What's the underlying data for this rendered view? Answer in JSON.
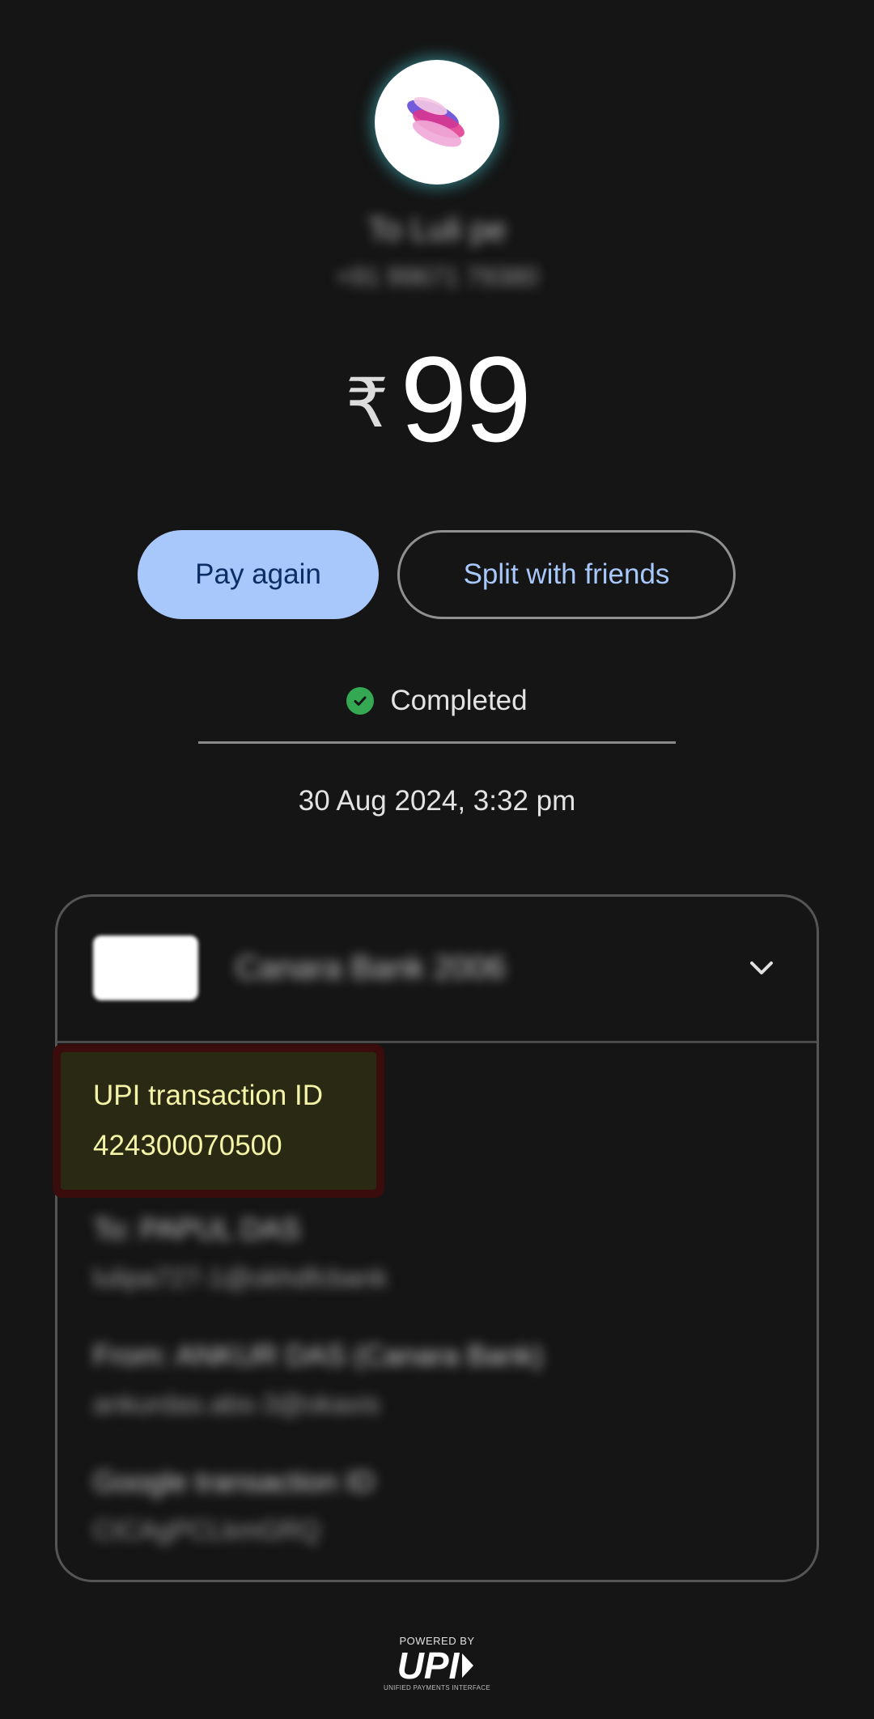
{
  "payee": {
    "name": "To Luli pe",
    "phone": "+91 99671 79380"
  },
  "amount": {
    "currency_symbol": "₹",
    "value": "99"
  },
  "actions": {
    "pay_again": "Pay again",
    "split": "Split with friends"
  },
  "status": {
    "label": "Completed",
    "color": "#34a853"
  },
  "datetime": "30 Aug 2024, 3:32 pm",
  "details": {
    "bank": "Canara Bank 2006",
    "upi_label": "UPI transaction ID",
    "upi_id": "424300070500",
    "to_title": "To: PAPUL DAS",
    "to_sub": "lulipa727-1@okhdfcbank",
    "from_title": "From: ANKUR DAS (Canara Bank)",
    "from_sub": "ankurdas.abs-3@okaxis",
    "google_title": "Google transaction ID",
    "google_sub": "CICAgPCLkmGRQ"
  },
  "footer": {
    "powered_by": "POWERED BY",
    "logo": "UPI",
    "tagline": "UNIFIED PAYMENTS INTERFACE"
  },
  "colors": {
    "accent": "#a8c7fa",
    "background": "#151515",
    "highlight_text": "#f4f4a8"
  }
}
